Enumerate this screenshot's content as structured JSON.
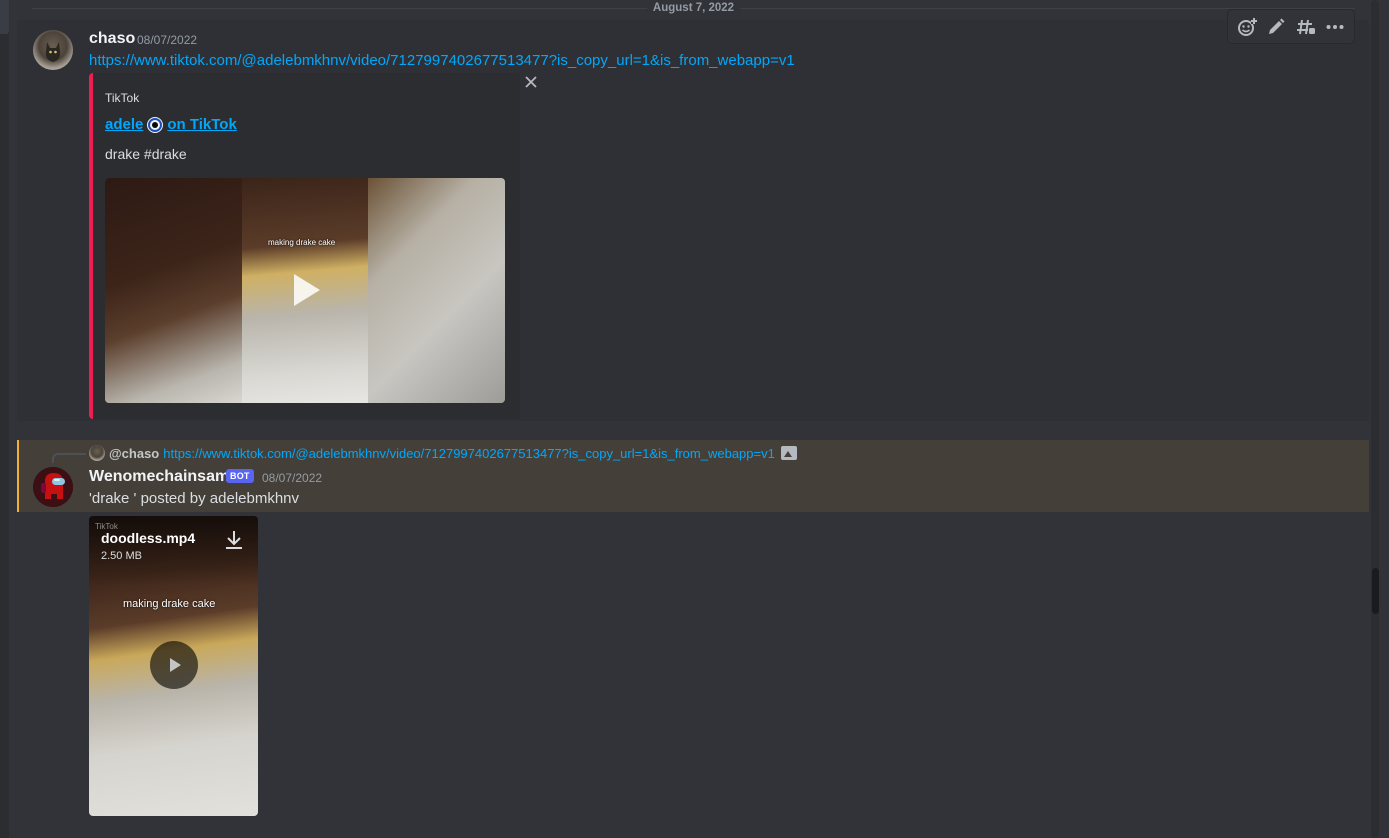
{
  "date_divider": "August 7, 2022",
  "message1": {
    "username": "chaso",
    "timestamp": "08/07/2022",
    "url": "https://www.tiktok.com/@adelebmkhnv/video/7127997402677513477?is_copy_url=1&is_from_webapp=v1",
    "embed": {
      "provider": "TikTok",
      "title_prefix": "adele",
      "title_suffix": "on TikTok",
      "description": "drake #drake",
      "video_caption": "making drake cake",
      "accent_color": "#ee1d52"
    }
  },
  "message2": {
    "reply_user": "@chaso",
    "reply_url": "https://www.tiktok.com/@adelebmkhnv/video/7127997402677513477?is_copy_url=1&is_from_webapp=v1",
    "username": "Wenomechainsama",
    "badge": "BOT",
    "timestamp": "08/07/2022",
    "text": "'drake ' posted by adelebmkhnv",
    "attachment": {
      "filename": "doodless.mp4",
      "size": "2.50 MB",
      "caption": "making drake cake",
      "watermark": "TikTok"
    },
    "highlight_color": "#f0b132"
  },
  "toolbar": {
    "icons": [
      "add-reaction-icon",
      "edit-icon",
      "create-thread-icon",
      "more-icon"
    ]
  }
}
